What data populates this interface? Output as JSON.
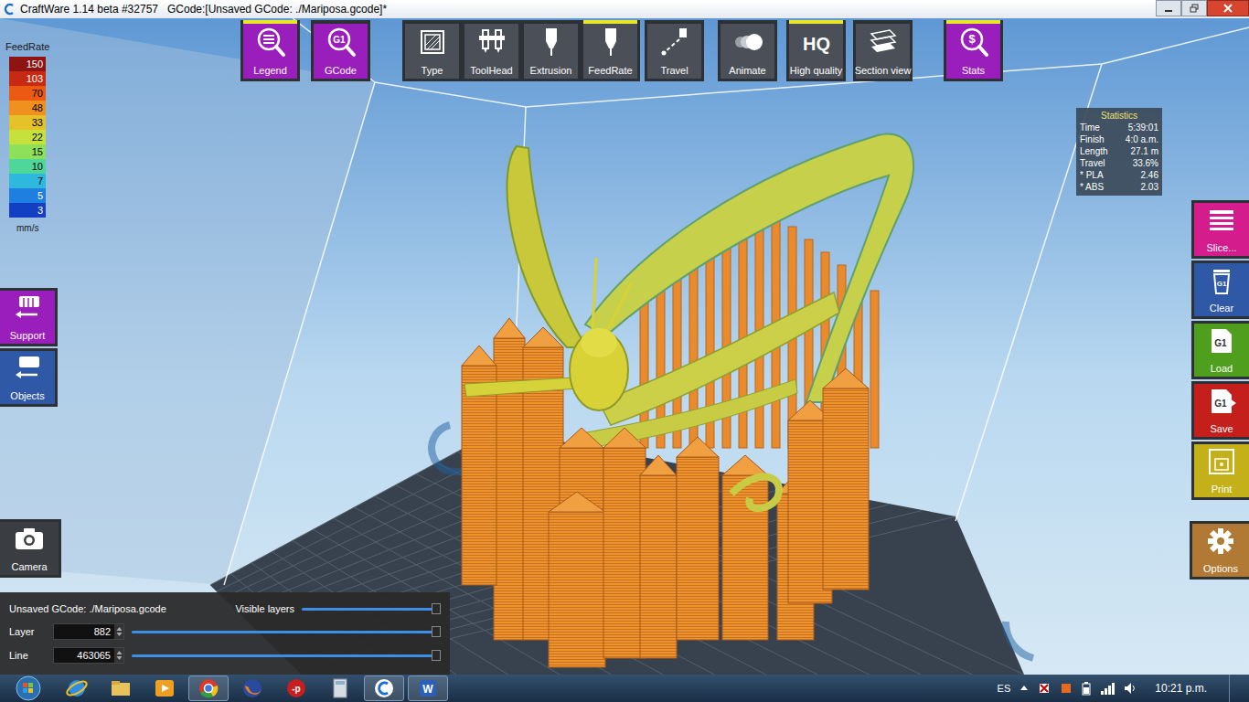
{
  "window": {
    "title": "CraftWare 1.14 beta #32757   GCode:[Unsaved GCode: ./Mariposa.gcode]*"
  },
  "toolbar": [
    {
      "label": "Legend",
      "kind": "legend",
      "icon_text": "",
      "selected": true,
      "color": "#9a1ebb"
    },
    {
      "label": "GCode",
      "kind": "gcode",
      "icon_text": "G1",
      "selected": false,
      "color": "#9a1ebb"
    },
    {
      "label": "Type",
      "kind": "type",
      "icon_text": "",
      "selected": false,
      "color": "#4b5058"
    },
    {
      "label": "ToolHead",
      "kind": "toolhead",
      "icon_text": "",
      "selected": false,
      "color": "#4b5058"
    },
    {
      "label": "Extrusion",
      "kind": "extrusion",
      "icon_text": "",
      "selected": false,
      "color": "#4b5058"
    },
    {
      "label": "FeedRate",
      "kind": "feedrate",
      "icon_text": "",
      "selected": true,
      "color": "#4b5058"
    },
    {
      "label": "Travel",
      "kind": "travel",
      "icon_text": "",
      "selected": false,
      "color": "#4b5058"
    },
    {
      "label": "Animate",
      "kind": "animate",
      "icon_text": "",
      "selected": false,
      "color": "#4b5058"
    },
    {
      "label": "High quality",
      "kind": "hq",
      "icon_text": "HQ",
      "selected": true,
      "color": "#4b5058"
    },
    {
      "label": "Section view",
      "kind": "section",
      "icon_text": "",
      "selected": false,
      "color": "#4b5058"
    },
    {
      "label": "Stats",
      "kind": "stats",
      "icon_text": "$",
      "selected": true,
      "color": "#9a1ebb"
    }
  ],
  "legend": {
    "title": "FeedRate",
    "unit": "mm/s",
    "entries": [
      {
        "value": "150",
        "color": "#8e1414"
      },
      {
        "value": "103",
        "color": "#c72a12"
      },
      {
        "value": "70",
        "color": "#ea5a12"
      },
      {
        "value": "48",
        "color": "#f0901e"
      },
      {
        "value": "33",
        "color": "#e6c22a"
      },
      {
        "value": "22",
        "color": "#c6e03c"
      },
      {
        "value": "15",
        "color": "#8ee05a"
      },
      {
        "value": "10",
        "color": "#4fd69a"
      },
      {
        "value": "7",
        "color": "#2fb8de"
      },
      {
        "value": "5",
        "color": "#1f7fe0"
      },
      {
        "value": "3",
        "color": "#1340c2"
      }
    ]
  },
  "statistics": {
    "title": "Statistics",
    "rows": [
      {
        "label": "Time",
        "value": "5:39:01"
      },
      {
        "label": "Finish",
        "value": "4:0 a.m."
      },
      {
        "label": "Length",
        "value": "27.1 m"
      },
      {
        "label": "Travel",
        "value": "33.6%"
      },
      {
        "label": "* PLA",
        "value": "2.46"
      },
      {
        "label": "* ABS",
        "value": "2.03"
      }
    ]
  },
  "right_buttons": [
    {
      "label": "Slice...",
      "kind": "slice",
      "icon_text": "",
      "color": "#d41c8c"
    },
    {
      "label": "Clear",
      "kind": "clear",
      "icon_text": "G1",
      "color": "#2f58a6"
    },
    {
      "label": "Load",
      "kind": "load",
      "icon_text": "G1",
      "color": "#4f9e1e"
    },
    {
      "label": "Save",
      "kind": "save",
      "icon_text": "G1",
      "color": "#c41f1b"
    },
    {
      "label": "Print",
      "kind": "print",
      "icon_text": "",
      "color": "#c4b018"
    }
  ],
  "left_buttons": [
    {
      "label": "Support",
      "kind": "support",
      "color": "#9a1ebb"
    },
    {
      "label": "Objects",
      "kind": "objects",
      "color": "#2f58a6"
    }
  ],
  "camera_button": {
    "label": "Camera"
  },
  "options_button": {
    "label": "Options"
  },
  "layer_panel": {
    "title": "Unsaved GCode: ./Mariposa.gcode",
    "visible_layers": {
      "label": "Visible layers",
      "level": 1
    },
    "rows": [
      {
        "label": "Layer",
        "value": "882",
        "level": 1
      },
      {
        "label": "Line",
        "value": "463065",
        "level": 1
      }
    ]
  },
  "taskbar": {
    "apps": [
      {
        "kind": "ie",
        "glyph": "",
        "running": false
      },
      {
        "kind": "explorer",
        "glyph": "",
        "running": false
      },
      {
        "kind": "media",
        "glyph": "",
        "running": false
      },
      {
        "kind": "chrome",
        "glyph": "",
        "running": true
      },
      {
        "kind": "firefox",
        "glyph": "",
        "running": false
      },
      {
        "kind": "pdf",
        "glyph": "-p",
        "running": false
      },
      {
        "kind": "calculator",
        "glyph": "",
        "running": false
      },
      {
        "kind": "craftware",
        "glyph": "",
        "running": true
      },
      {
        "kind": "word",
        "glyph": "W",
        "running": true
      }
    ],
    "language": "ES",
    "time": "10:21 p.m."
  }
}
